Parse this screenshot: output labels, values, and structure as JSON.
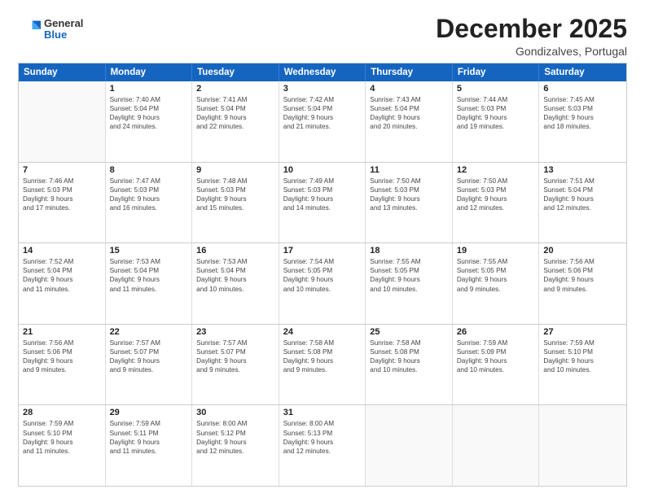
{
  "header": {
    "logo_general": "General",
    "logo_blue": "Blue",
    "month": "December 2025",
    "location": "Gondizalves, Portugal"
  },
  "weekdays": [
    "Sunday",
    "Monday",
    "Tuesday",
    "Wednesday",
    "Thursday",
    "Friday",
    "Saturday"
  ],
  "rows": [
    [
      {
        "day": "",
        "empty": true
      },
      {
        "day": "1",
        "line1": "Sunrise: 7:40 AM",
        "line2": "Sunset: 5:04 PM",
        "line3": "Daylight: 9 hours",
        "line4": "and 24 minutes."
      },
      {
        "day": "2",
        "line1": "Sunrise: 7:41 AM",
        "line2": "Sunset: 5:04 PM",
        "line3": "Daylight: 9 hours",
        "line4": "and 22 minutes."
      },
      {
        "day": "3",
        "line1": "Sunrise: 7:42 AM",
        "line2": "Sunset: 5:04 PM",
        "line3": "Daylight: 9 hours",
        "line4": "and 21 minutes."
      },
      {
        "day": "4",
        "line1": "Sunrise: 7:43 AM",
        "line2": "Sunset: 5:04 PM",
        "line3": "Daylight: 9 hours",
        "line4": "and 20 minutes."
      },
      {
        "day": "5",
        "line1": "Sunrise: 7:44 AM",
        "line2": "Sunset: 5:03 PM",
        "line3": "Daylight: 9 hours",
        "line4": "and 19 minutes."
      },
      {
        "day": "6",
        "line1": "Sunrise: 7:45 AM",
        "line2": "Sunset: 5:03 PM",
        "line3": "Daylight: 9 hours",
        "line4": "and 18 minutes."
      }
    ],
    [
      {
        "day": "7",
        "line1": "Sunrise: 7:46 AM",
        "line2": "Sunset: 5:03 PM",
        "line3": "Daylight: 9 hours",
        "line4": "and 17 minutes."
      },
      {
        "day": "8",
        "line1": "Sunrise: 7:47 AM",
        "line2": "Sunset: 5:03 PM",
        "line3": "Daylight: 9 hours",
        "line4": "and 16 minutes."
      },
      {
        "day": "9",
        "line1": "Sunrise: 7:48 AM",
        "line2": "Sunset: 5:03 PM",
        "line3": "Daylight: 9 hours",
        "line4": "and 15 minutes."
      },
      {
        "day": "10",
        "line1": "Sunrise: 7:49 AM",
        "line2": "Sunset: 5:03 PM",
        "line3": "Daylight: 9 hours",
        "line4": "and 14 minutes."
      },
      {
        "day": "11",
        "line1": "Sunrise: 7:50 AM",
        "line2": "Sunset: 5:03 PM",
        "line3": "Daylight: 9 hours",
        "line4": "and 13 minutes."
      },
      {
        "day": "12",
        "line1": "Sunrise: 7:50 AM",
        "line2": "Sunset: 5:03 PM",
        "line3": "Daylight: 9 hours",
        "line4": "and 12 minutes."
      },
      {
        "day": "13",
        "line1": "Sunrise: 7:51 AM",
        "line2": "Sunset: 5:04 PM",
        "line3": "Daylight: 9 hours",
        "line4": "and 12 minutes."
      }
    ],
    [
      {
        "day": "14",
        "line1": "Sunrise: 7:52 AM",
        "line2": "Sunset: 5:04 PM",
        "line3": "Daylight: 9 hours",
        "line4": "and 11 minutes."
      },
      {
        "day": "15",
        "line1": "Sunrise: 7:53 AM",
        "line2": "Sunset: 5:04 PM",
        "line3": "Daylight: 9 hours",
        "line4": "and 11 minutes."
      },
      {
        "day": "16",
        "line1": "Sunrise: 7:53 AM",
        "line2": "Sunset: 5:04 PM",
        "line3": "Daylight: 9 hours",
        "line4": "and 10 minutes."
      },
      {
        "day": "17",
        "line1": "Sunrise: 7:54 AM",
        "line2": "Sunset: 5:05 PM",
        "line3": "Daylight: 9 hours",
        "line4": "and 10 minutes."
      },
      {
        "day": "18",
        "line1": "Sunrise: 7:55 AM",
        "line2": "Sunset: 5:05 PM",
        "line3": "Daylight: 9 hours",
        "line4": "and 10 minutes."
      },
      {
        "day": "19",
        "line1": "Sunrise: 7:55 AM",
        "line2": "Sunset: 5:05 PM",
        "line3": "Daylight: 9 hours",
        "line4": "and 9 minutes."
      },
      {
        "day": "20",
        "line1": "Sunrise: 7:56 AM",
        "line2": "Sunset: 5:06 PM",
        "line3": "Daylight: 9 hours",
        "line4": "and 9 minutes."
      }
    ],
    [
      {
        "day": "21",
        "line1": "Sunrise: 7:56 AM",
        "line2": "Sunset: 5:06 PM",
        "line3": "Daylight: 9 hours",
        "line4": "and 9 minutes."
      },
      {
        "day": "22",
        "line1": "Sunrise: 7:57 AM",
        "line2": "Sunset: 5:07 PM",
        "line3": "Daylight: 9 hours",
        "line4": "and 9 minutes."
      },
      {
        "day": "23",
        "line1": "Sunrise: 7:57 AM",
        "line2": "Sunset: 5:07 PM",
        "line3": "Daylight: 9 hours",
        "line4": "and 9 minutes."
      },
      {
        "day": "24",
        "line1": "Sunrise: 7:58 AM",
        "line2": "Sunset: 5:08 PM",
        "line3": "Daylight: 9 hours",
        "line4": "and 9 minutes."
      },
      {
        "day": "25",
        "line1": "Sunrise: 7:58 AM",
        "line2": "Sunset: 5:08 PM",
        "line3": "Daylight: 9 hours",
        "line4": "and 10 minutes."
      },
      {
        "day": "26",
        "line1": "Sunrise: 7:59 AM",
        "line2": "Sunset: 5:09 PM",
        "line3": "Daylight: 9 hours",
        "line4": "and 10 minutes."
      },
      {
        "day": "27",
        "line1": "Sunrise: 7:59 AM",
        "line2": "Sunset: 5:10 PM",
        "line3": "Daylight: 9 hours",
        "line4": "and 10 minutes."
      }
    ],
    [
      {
        "day": "28",
        "line1": "Sunrise: 7:59 AM",
        "line2": "Sunset: 5:10 PM",
        "line3": "Daylight: 9 hours",
        "line4": "and 11 minutes."
      },
      {
        "day": "29",
        "line1": "Sunrise: 7:59 AM",
        "line2": "Sunset: 5:11 PM",
        "line3": "Daylight: 9 hours",
        "line4": "and 11 minutes."
      },
      {
        "day": "30",
        "line1": "Sunrise: 8:00 AM",
        "line2": "Sunset: 5:12 PM",
        "line3": "Daylight: 9 hours",
        "line4": "and 12 minutes."
      },
      {
        "day": "31",
        "line1": "Sunrise: 8:00 AM",
        "line2": "Sunset: 5:13 PM",
        "line3": "Daylight: 9 hours",
        "line4": "and 12 minutes."
      },
      {
        "day": "",
        "empty": true
      },
      {
        "day": "",
        "empty": true
      },
      {
        "day": "",
        "empty": true
      }
    ]
  ]
}
